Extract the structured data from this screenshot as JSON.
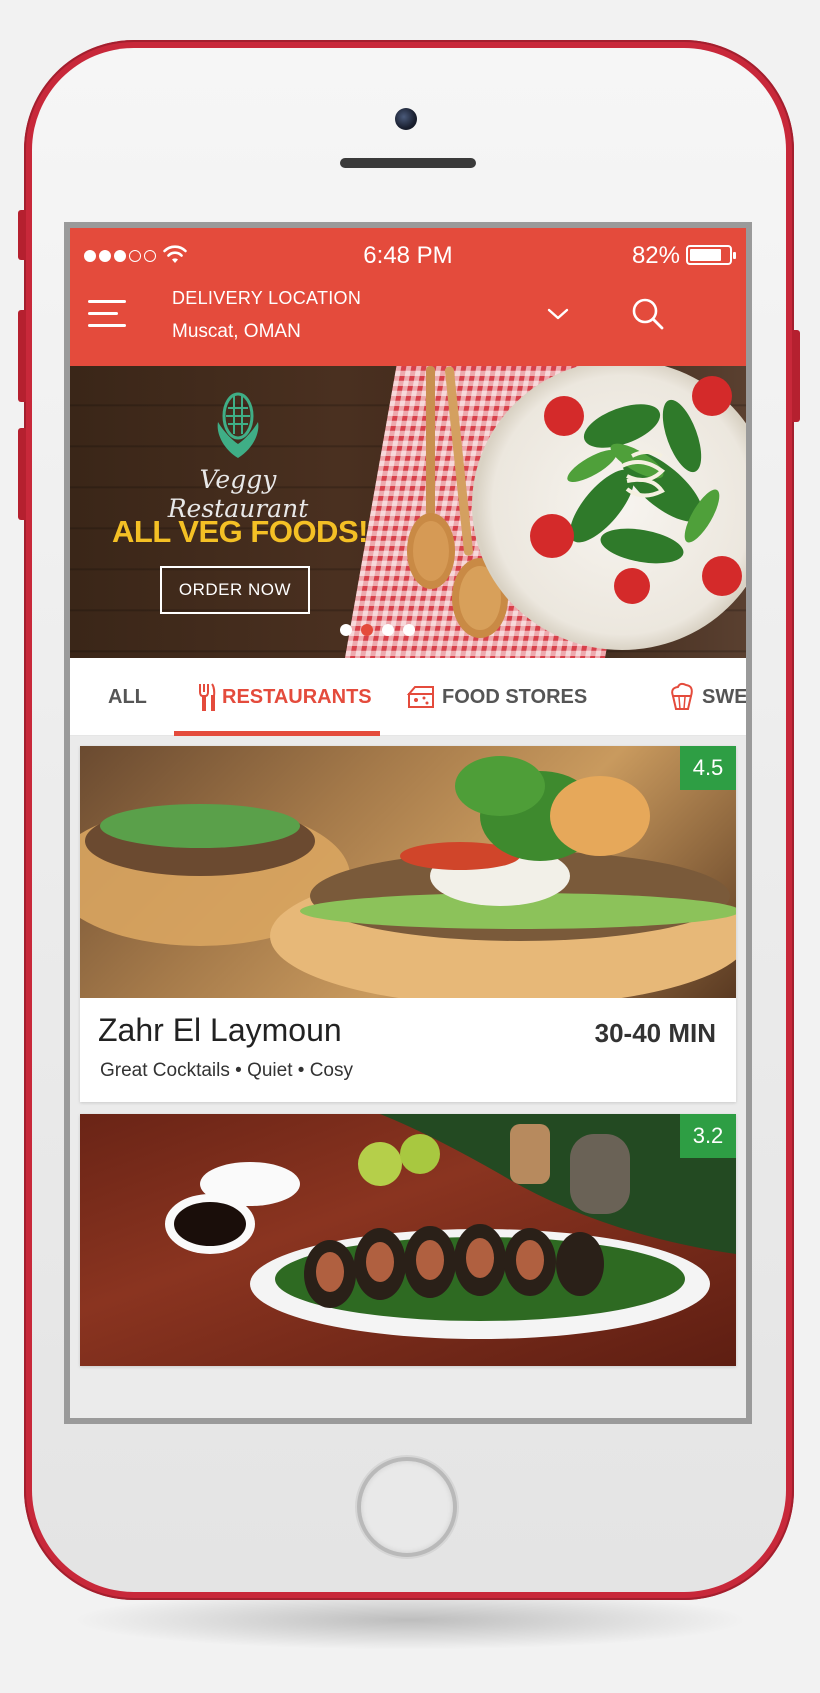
{
  "status_bar": {
    "time": "6:48 PM",
    "battery_percent": "82%",
    "battery_level": 0.82,
    "signal_dots_filled": 3,
    "signal_dots_total": 5
  },
  "header": {
    "location_label": "DELIVERY LOCATION",
    "location_value": "Muscat, OMAN",
    "icons": [
      "menu-icon",
      "chevron-down-icon",
      "search-icon"
    ]
  },
  "banner": {
    "brand": "Veggy Restaurant",
    "headline": "ALL VEG FOODS!",
    "cta": "ORDER NOW",
    "slide_count": 4,
    "active_slide": 2
  },
  "tabs": [
    {
      "label": "ALL",
      "icon": ""
    },
    {
      "label": "RESTAURANTS",
      "icon": "fork-knife-icon",
      "active": true
    },
    {
      "label": "FOOD STORES",
      "icon": "store-icon"
    },
    {
      "label": "SWE",
      "icon": "cupcake-icon"
    }
  ],
  "restaurants": [
    {
      "name": "Zahr El Laymoun",
      "time": "30-40 MIN",
      "tags": "Great Cocktails • Quiet • Cosy",
      "rating": "4.5"
    },
    {
      "name": "",
      "time": "",
      "tags": "",
      "rating": "3.2"
    }
  ],
  "colors": {
    "primary": "#e44b3c",
    "rating_bg": "#2e9e44",
    "headline": "#f4c025",
    "phone_frame": "#c8283a"
  }
}
